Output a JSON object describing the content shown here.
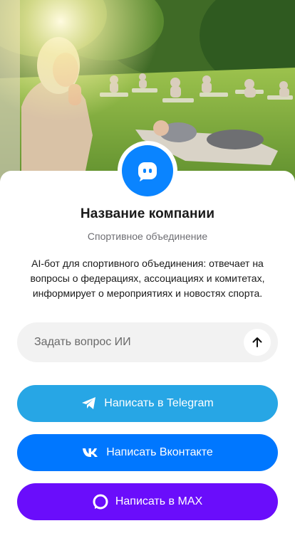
{
  "hero": {
    "image_alt": "people doing yoga in a sunny park"
  },
  "company": {
    "name": "Название компании",
    "category": "Спортивное объединение",
    "description": "AI-бот для спортивного объединения: отвечает на вопросы о федерациях, ассоциациях и комитетах, информирует о мероприятиях и новостях спорта."
  },
  "ask": {
    "placeholder": "Задать вопрос ИИ",
    "value": ""
  },
  "buttons": {
    "telegram": "Написать в Telegram",
    "vk": "Написать Вконтакте",
    "max": "Написать в MAX"
  },
  "icons": {
    "avatar": "chat-bot-icon",
    "send": "arrow-up-icon",
    "telegram": "telegram-icon",
    "vk": "vk-icon",
    "max": "max-icon"
  },
  "colors": {
    "accent": "#0a84ff",
    "telegram": "#27a6e5",
    "vk": "#0077ff",
    "max": "#6a0dfb"
  }
}
